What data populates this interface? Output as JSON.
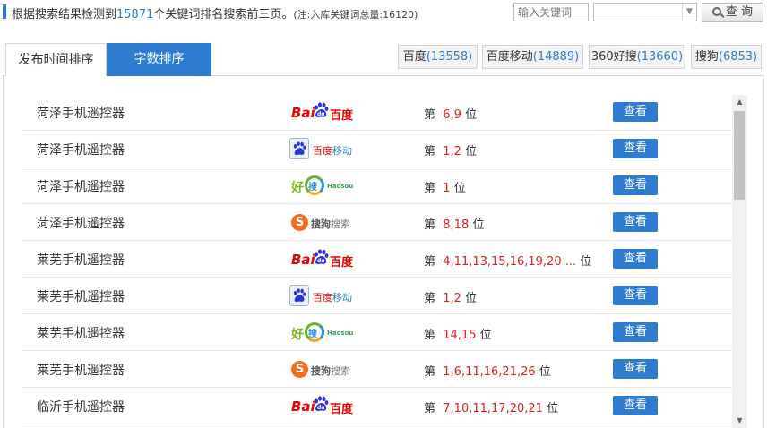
{
  "header": {
    "summary_prefix": "根据搜索结果检测到",
    "keyword_count": "15871",
    "summary_suffix": "个关键词排名搜索前三页。",
    "note": "(注:入库关键词总量:16120)"
  },
  "search": {
    "placeholder": "输入关键词",
    "select_value": "",
    "query_label": "查 询"
  },
  "tabs": [
    {
      "label": "发布时间排序"
    },
    {
      "label": "字数排序"
    }
  ],
  "engines": [
    {
      "name": "百度",
      "count": "(13558)"
    },
    {
      "name": "百度移动",
      "count": "(14889)"
    },
    {
      "name": "360好搜",
      "count": "(13660)"
    },
    {
      "name": "搜狗",
      "count": "(6853)"
    }
  ],
  "rows": [
    {
      "keyword": "菏泽手机遥控器",
      "engine": "baidu",
      "prefix": "第",
      "positions": "6,9",
      "suffix": "位",
      "action": "查看"
    },
    {
      "keyword": "菏泽手机遥控器",
      "engine": "baidu-mobile",
      "prefix": "第",
      "positions": "1,2",
      "suffix": "位",
      "action": "查看"
    },
    {
      "keyword": "菏泽手机遥控器",
      "engine": "haosou",
      "prefix": "第",
      "positions": "1",
      "suffix": "位",
      "action": "查看"
    },
    {
      "keyword": "菏泽手机遥控器",
      "engine": "sogou",
      "prefix": "第",
      "positions": "8,18",
      "suffix": "位",
      "action": "查看"
    },
    {
      "keyword": "莱芜手机遥控器",
      "engine": "baidu",
      "prefix": "第",
      "positions": "4,11,13,15,16,19,20 ...",
      "suffix": "位",
      "action": "查看"
    },
    {
      "keyword": "莱芜手机遥控器",
      "engine": "baidu-mobile",
      "prefix": "第",
      "positions": "1,2",
      "suffix": "位",
      "action": "查看"
    },
    {
      "keyword": "莱芜手机遥控器",
      "engine": "haosou",
      "prefix": "第",
      "positions": "14,15",
      "suffix": "位",
      "action": "查看"
    },
    {
      "keyword": "莱芜手机遥控器",
      "engine": "sogou",
      "prefix": "第",
      "positions": "1,6,11,16,21,26",
      "suffix": "位",
      "action": "查看"
    },
    {
      "keyword": "临沂手机遥控器",
      "engine": "baidu",
      "prefix": "第",
      "positions": "7,10,11,17,20,21",
      "suffix": "位",
      "action": "查看"
    }
  ],
  "logos": {
    "baidu": {
      "part1": "Bai",
      "part2": "百度"
    },
    "baidu_mobile": {
      "red": "百度",
      "blue": "移动"
    },
    "haosou": {
      "hao": "好",
      "sou": "搜",
      "en": "Haosou"
    },
    "sogou": {
      "icon": "S",
      "bold": "搜狗",
      "light": "搜索"
    }
  },
  "icons": {
    "query": "search-icon",
    "select_arrow": "chevron-down-icon",
    "scroll_up": "triangle-up-icon",
    "scroll_down": "triangle-down-icon"
  },
  "colors": {
    "accent": "#2e7cd0",
    "rank_red": "#e02020",
    "baidu_red": "#e10601"
  }
}
